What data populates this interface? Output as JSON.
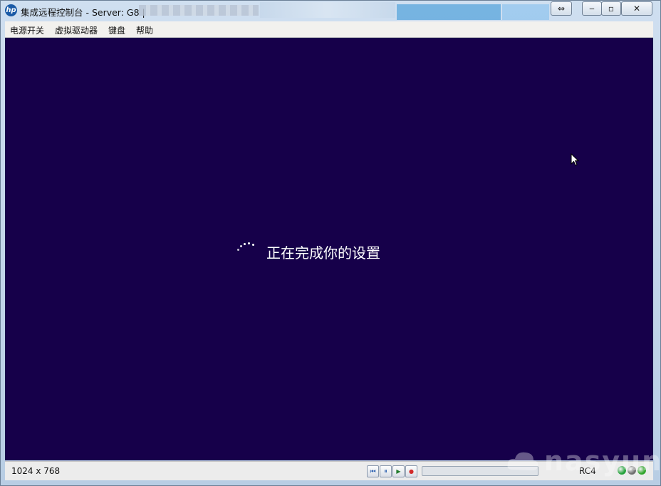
{
  "window": {
    "title": "集成远程控制台 - Server: G8 |",
    "logo_text": "hp"
  },
  "window_controls": {
    "swap_glyph": "⇔",
    "minimize_glyph": "‒",
    "maximize_glyph": "▫",
    "close_glyph": "✕"
  },
  "menu": {
    "items": [
      "电源开关",
      "虚拟驱动器",
      "键盘",
      "帮助"
    ]
  },
  "screen": {
    "background": "#16004a",
    "message": "正在完成你的设置"
  },
  "status": {
    "resolution": "1024 x 768",
    "cipher": "RC4",
    "progress": 0.0,
    "playback": {
      "rewind_glyph": "⏮",
      "pause_glyph": "⏸",
      "play_glyph": "▶",
      "record_glyph": "●"
    },
    "leds": [
      {
        "name": "led-green",
        "color": "#23a23a"
      },
      {
        "name": "led-gray",
        "color": "#6f6f6f"
      },
      {
        "name": "led-power",
        "color": "#2fa52a"
      }
    ]
  },
  "watermark": {
    "text": "nasyun"
  }
}
